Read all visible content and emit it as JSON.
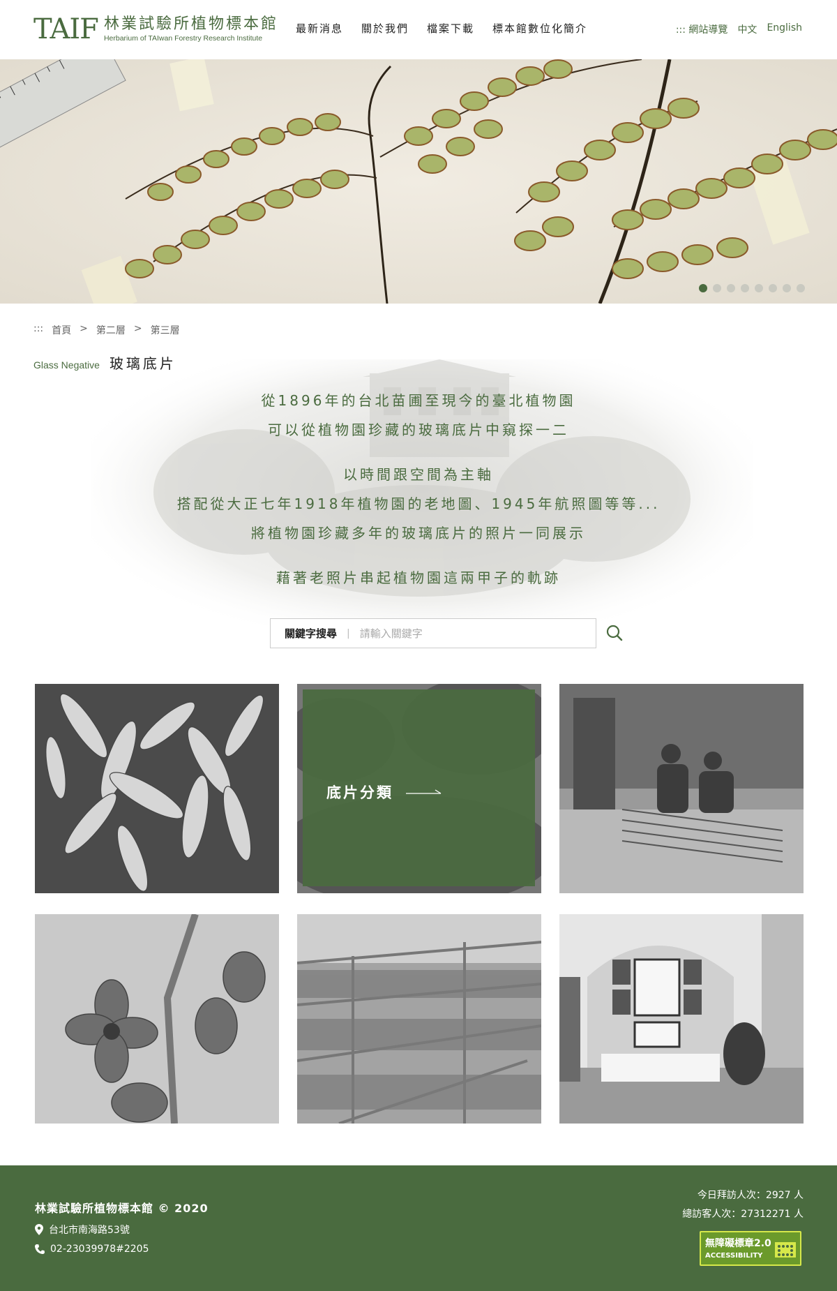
{
  "header": {
    "logo_mark": "TAIF",
    "logo_cn": "林業試驗所植物標本館",
    "logo_en": "Herbarium of TAIwan Forestry Research Institute",
    "nav": [
      "最新消息",
      "關於我們",
      "檔案下載",
      "標本館數位化簡介"
    ],
    "sitemap": "::: 網站導覽",
    "lang_zh": "中文",
    "lang_en": "English"
  },
  "banner": {
    "slide_count": 8,
    "active_slide": 1
  },
  "breadcrumb": {
    "prefix": ":::",
    "items": [
      "首頁",
      "第二層",
      "第三層"
    ],
    "separator": ">"
  },
  "page": {
    "title_en": "Glass Negative",
    "title_cn": "玻璃底片"
  },
  "intro": {
    "lines": [
      "從1896年的台北苗圃至現今的臺北植物園",
      "可以從植物園珍藏的玻璃底片中窺探一二",
      "以時間跟空間為主軸",
      "搭配從大正七年1918年植物園的老地圖、1945年航照圖等等...",
      "將植物園珍藏多年的玻璃底片的照片一同展示",
      "藉著老照片串起植物園這兩甲子的軌跡"
    ]
  },
  "search": {
    "label": "關鍵字搜尋",
    "divider": "|",
    "placeholder": "請輸入關鍵字"
  },
  "category": {
    "label": "底片分類"
  },
  "footer": {
    "name": "林業試驗所植物標本館 © 2020",
    "address": "台北市南海路53號",
    "phone": "02-23039978#2205",
    "today_visits": "今日拜訪人次：2927 人",
    "total_visits": "總訪客人次：27312271 人",
    "badge_line1": "無障礙標章2.0",
    "badge_line2": "ACCESSIBILITY"
  },
  "colors": {
    "brand_green": "#4a6b3f",
    "badge_green": "#6b9a2b"
  },
  "icons": [
    "search-icon",
    "map-pin-icon",
    "phone-icon",
    "arrow-right-icon",
    "accessibility-icon"
  ]
}
